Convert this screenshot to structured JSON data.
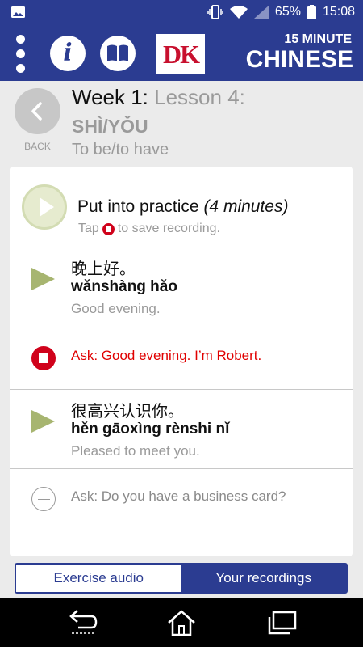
{
  "status": {
    "battery": "65%",
    "time": "15:08"
  },
  "header": {
    "logo_text": "DK",
    "title_top": "15 MINUTE",
    "title_main": "CHINESE",
    "info_glyph": "i"
  },
  "lesson": {
    "back_label": "BACK",
    "week": "Week 1:",
    "lesson_num": "Lesson 4:",
    "title": "SHÌ/YǑU",
    "subtitle": "To be/to have"
  },
  "practice": {
    "title": "Put into practice",
    "duration": "(4 minutes)",
    "hint_pre": "Tap",
    "hint_post": "to save recording."
  },
  "phrases": [
    {
      "chinese": "晚上好。",
      "pinyin": "wǎnshàng hǎo",
      "english": "Good evening."
    },
    {
      "chinese": "很高兴认识你。",
      "pinyin": "hěn gāoxìng rènshi nǐ",
      "english": "Pleased to meet you."
    }
  ],
  "asks": {
    "recording": "Ask: Good evening. I’m Robert.",
    "pending": "Ask: Do you have a business card?"
  },
  "tabs": {
    "exercise_audio": "Exercise audio",
    "your_recordings": "Your recordings"
  },
  "colors": {
    "brand_blue": "#2b3c91",
    "record_red": "#d0021b",
    "play_green": "#a7b570"
  }
}
